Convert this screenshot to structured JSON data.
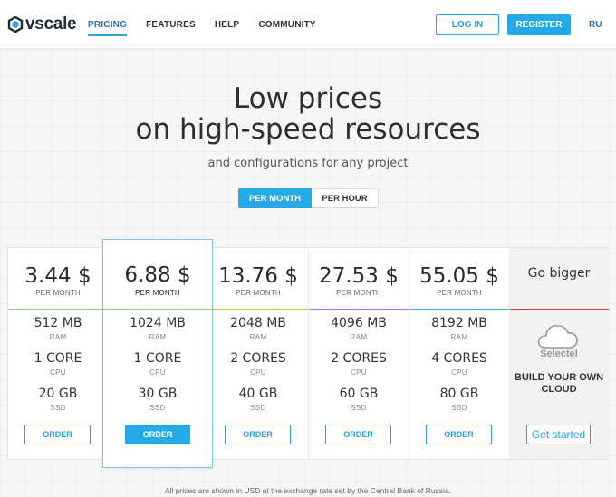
{
  "header": {
    "logo_text": "vscale",
    "nav": [
      "PRICING",
      "FEATURES",
      "HELP",
      "COMMUNITY"
    ],
    "login": "LOG IN",
    "register": "REGISTER",
    "lang": "RU"
  },
  "hero": {
    "title_line1": "Low prices",
    "title_line2": "on high-speed resources",
    "subtitle": "and configurations for any project",
    "toggle_month": "PER MONTH",
    "toggle_hour": "PER HOUR"
  },
  "labels": {
    "ram": "RAM",
    "cpu": "CPU",
    "ssd": "SSD",
    "order": "ORDER"
  },
  "plans": [
    {
      "price": "3.44 $",
      "per": "PER MONTH",
      "ram": "512 MB",
      "cpu": "1 CORE",
      "ssd": "20 GB",
      "color": "#8ad36b"
    },
    {
      "price": "6.88 $",
      "per": "PER MONTH",
      "ram": "1024 MB",
      "cpu": "1 CORE",
      "ssd": "30 GB",
      "color": "#8ad36b"
    },
    {
      "price": "13.76 $",
      "per": "PER MONTH",
      "ram": "2048 MB",
      "cpu": "2 CORES",
      "ssd": "40 GB",
      "color": "#f0c419"
    },
    {
      "price": "27.53 $",
      "per": "PER MONTH",
      "ram": "4096 MB",
      "cpu": "2 CORES",
      "ssd": "60 GB",
      "color": "#b36be0"
    },
    {
      "price": "55.05 $",
      "per": "PER MONTH",
      "ram": "8192 MB",
      "cpu": "4 CORES",
      "ssd": "80 GB",
      "color": "#3bb3e6"
    }
  ],
  "bigger": {
    "title": "Go bigger",
    "brand": "Selectel",
    "desc_line1": "BUILD YOUR OWN",
    "desc_line2": "CLOUD",
    "cta": "Get started"
  },
  "footnote": "All prices are shown in USD at the exchange rate set by the Central Bank of Russia."
}
